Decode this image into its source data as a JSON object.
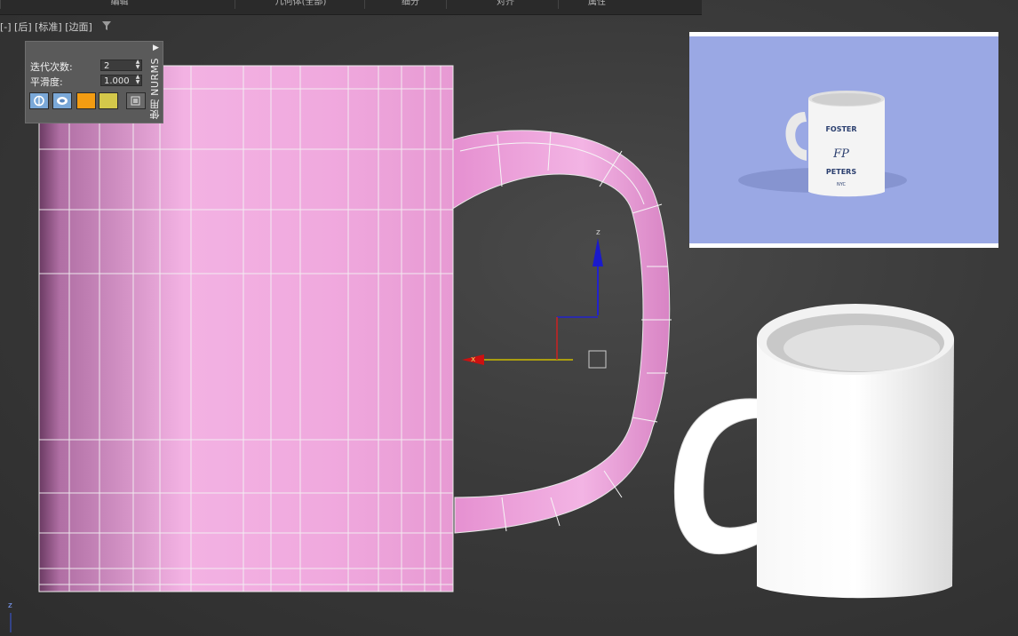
{
  "ribbon": {
    "tabs": [
      {
        "label": "编辑"
      },
      {
        "label": "几何体(全部)"
      },
      {
        "label": "细分"
      },
      {
        "label": "对齐"
      },
      {
        "label": "属性"
      }
    ]
  },
  "viewport": {
    "label": "[-] [后] [标准] [边面]",
    "filter_icon": "filter-icon"
  },
  "nurms": {
    "iterations_label": "迭代次数:",
    "iterations_value": "2",
    "smoothness_label": "平滑度:",
    "smoothness_value": "1.000",
    "side_label": "使用 NURMS",
    "button_colors": [
      "#f39c12",
      "#d4c84a"
    ]
  },
  "gizmo": {
    "x_label": "x",
    "z_label": "z"
  },
  "corner_axis": {
    "label": "z"
  },
  "colors": {
    "mug_pink": "#f0a8e0",
    "reference_bg": "#9aa8e4",
    "gizmo_x": "#cc1111",
    "gizmo_z": "#1111cc",
    "gizmo_y": "#ccbb00"
  },
  "reference_photo": {
    "logo_text_top": "FOSTER",
    "logo_text_bottom": "PETERS",
    "logo_monogram": "FP",
    "logo_sub": "NYC"
  }
}
